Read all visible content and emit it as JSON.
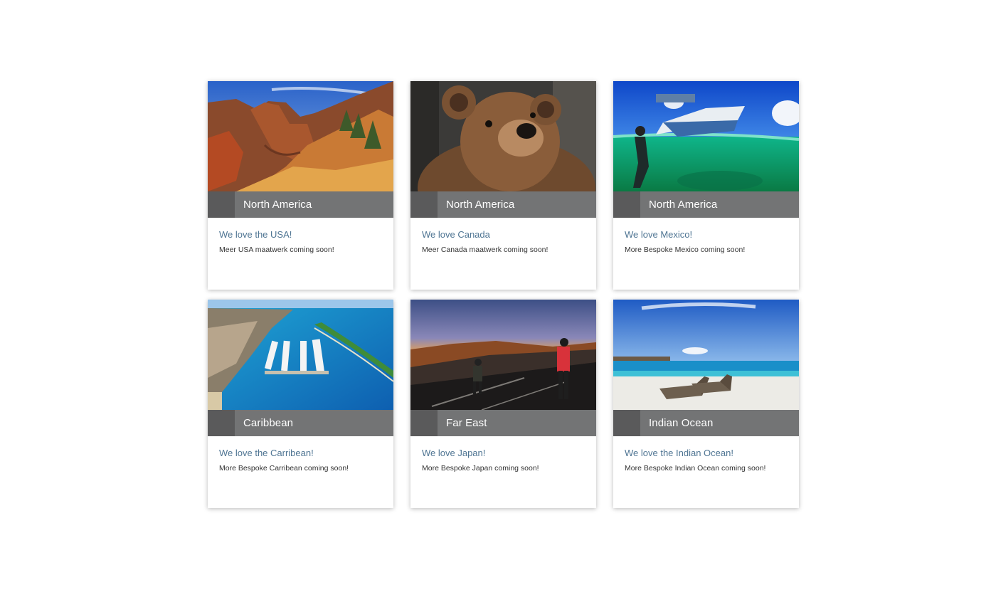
{
  "cards": [
    {
      "region": "North America",
      "title": "We love the USA!",
      "text": "Meer USA maatwerk coming soon!",
      "image": "canyon-landscape"
    },
    {
      "region": "North America",
      "title": "We love Canada",
      "text": "Meer Canada maatwerk coming soon!",
      "image": "brown-bear"
    },
    {
      "region": "North America",
      "title": "We love Mexico!",
      "text": "More Bespoke Mexico coming soon!",
      "image": "boat-snorkeling"
    },
    {
      "region": "Caribbean",
      "title": "We love the Carribean!",
      "text": "More Bespoke Carribean coming soon!",
      "image": "cruise-port-aerial"
    },
    {
      "region": "Far East",
      "title": "We love Japan!",
      "text": "More Bespoke Japan coming soon!",
      "image": "mountain-sunset-hikers"
    },
    {
      "region": "Indian Ocean",
      "title": "We love the Indian Ocean!",
      "text": "More Bespoke Indian Ocean coming soon!",
      "image": "beach-loungers"
    }
  ],
  "colors": {
    "region_bar": "#737475",
    "region_swatch": "#5a5a5b",
    "title_link": "#4f7593"
  }
}
